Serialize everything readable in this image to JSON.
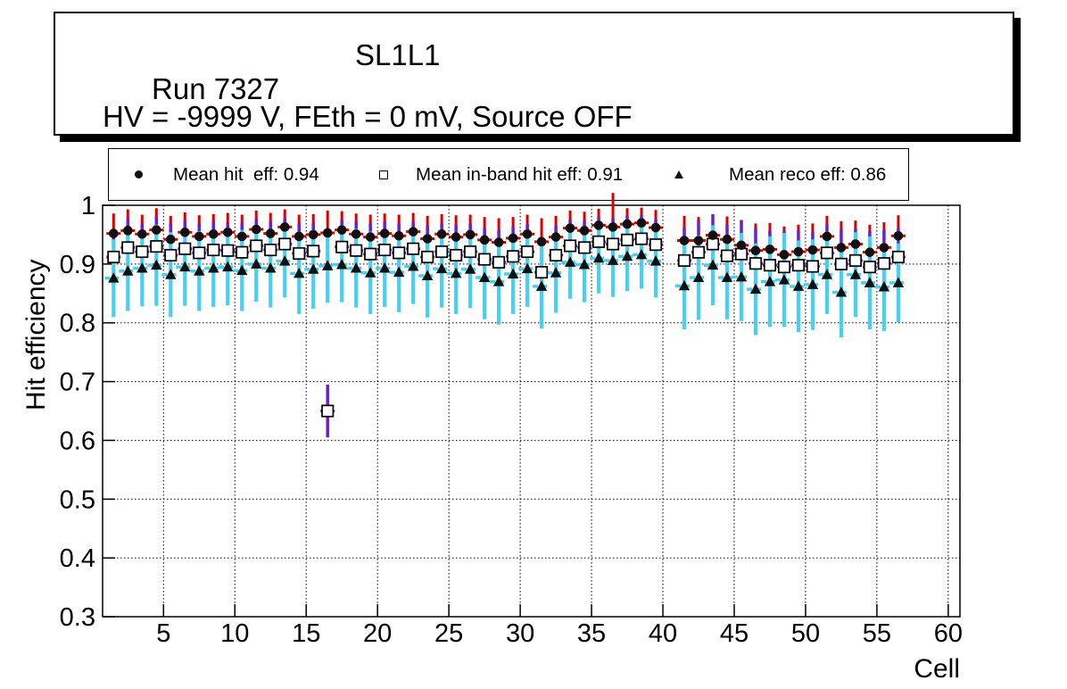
{
  "header": {
    "run_label": "Run 7327",
    "board_label": "SL1L1",
    "conditions_label": "HV = -9999 V, FEth = 0 mV, Source OFF"
  },
  "axes": {
    "y_title": "Hit efficiency",
    "x_title": "Cell"
  },
  "colors": {
    "hit_bar": "#d80000",
    "inband_bar": "#6a1fd6",
    "reco_bar": "#45d0f5",
    "marker": "#111111",
    "frame": "#000000"
  },
  "chart_data": {
    "type": "scatter",
    "title": "",
    "xlabel": "Cell",
    "ylabel": "Hit efficiency",
    "xlim": [
      0.73,
      60.82
    ],
    "ylim": [
      0.3,
      1.0
    ],
    "x_ticks": [
      5,
      10,
      15,
      20,
      25,
      30,
      35,
      40,
      45,
      50,
      55,
      60
    ],
    "y_ticks": [
      1,
      0.9,
      0.8,
      0.7,
      0.6,
      0.5,
      0.4,
      0.3
    ],
    "y_tick_labels": [
      "1",
      "0.9",
      "0.8",
      "0.7",
      "0.6",
      "0.5",
      "0.4",
      "0.3"
    ],
    "grid": true,
    "legend_position": "top",
    "point_x_offset": 0.5,
    "x_error_half_width": 0.5,
    "cells": [
      1,
      2,
      3,
      4,
      5,
      6,
      7,
      8,
      9,
      10,
      11,
      12,
      13,
      14,
      15,
      16,
      17,
      18,
      19,
      20,
      21,
      22,
      23,
      24,
      25,
      26,
      27,
      28,
      29,
      30,
      31,
      32,
      33,
      34,
      35,
      36,
      37,
      38,
      39,
      41,
      42,
      43,
      44,
      45,
      46,
      47,
      48,
      49,
      50,
      51,
      52,
      53,
      54,
      55,
      56
    ],
    "series": [
      {
        "name": "Mean hit  eff: 0.94",
        "mean": 0.94,
        "marker": "filled-circle",
        "marker_color": "#111111",
        "bar_color": "#d80000",
        "cap_style": "solid",
        "values": [
          0.952,
          0.957,
          0.951,
          0.958,
          0.942,
          0.954,
          0.947,
          0.951,
          0.954,
          0.947,
          0.959,
          0.952,
          0.963,
          0.947,
          0.95,
          0.953,
          0.958,
          0.951,
          0.946,
          0.952,
          0.948,
          0.955,
          0.943,
          0.951,
          0.946,
          0.95,
          0.941,
          0.937,
          0.944,
          0.951,
          0.938,
          0.946,
          0.961,
          0.957,
          0.966,
          0.963,
          0.968,
          0.97,
          0.962,
          0.94,
          0.94,
          0.949,
          0.942,
          0.932,
          0.923,
          0.925,
          0.916,
          0.921,
          0.924,
          0.947,
          0.928,
          0.934,
          0.92,
          0.928,
          0.948
        ],
        "errors": [
          0.034,
          0.036,
          0.033,
          0.037,
          0.04,
          0.034,
          0.036,
          0.034,
          0.033,
          0.037,
          0.032,
          0.035,
          0.03,
          0.037,
          0.035,
          0.038,
          0.032,
          0.035,
          0.038,
          0.034,
          0.036,
          0.032,
          0.039,
          0.034,
          0.037,
          0.034,
          0.039,
          0.041,
          0.036,
          0.033,
          0.04,
          0.036,
          0.03,
          0.032,
          0.028,
          0.058,
          0.027,
          0.026,
          0.03,
          0.042,
          0.04,
          0.036,
          0.039,
          0.043,
          0.046,
          0.045,
          0.048,
          0.046,
          0.045,
          0.035,
          0.045,
          0.04,
          0.047,
          0.043,
          0.035
        ]
      },
      {
        "name": "Mean in-band hit eff: 0.91",
        "mean": 0.91,
        "marker": "open-square",
        "marker_color": "#000000",
        "bar_color": "#6a1fd6",
        "cap_style": "solid",
        "values": [
          0.912,
          0.928,
          0.921,
          0.93,
          0.915,
          0.926,
          0.919,
          0.924,
          0.923,
          0.92,
          0.931,
          0.924,
          0.934,
          0.918,
          0.922,
          0.65,
          0.929,
          0.923,
          0.917,
          0.924,
          0.919,
          0.926,
          0.912,
          0.921,
          0.915,
          0.921,
          0.908,
          0.903,
          0.913,
          0.921,
          0.886,
          0.915,
          0.931,
          0.928,
          0.938,
          0.934,
          0.941,
          0.943,
          0.933,
          0.906,
          0.92,
          0.934,
          0.914,
          0.917,
          0.901,
          0.898,
          0.895,
          0.898,
          0.896,
          0.919,
          0.9,
          0.906,
          0.895,
          0.901,
          0.912
        ],
        "errors": [
          0.048,
          0.05,
          0.047,
          0.051,
          0.054,
          0.048,
          0.05,
          0.048,
          0.047,
          0.051,
          0.046,
          0.049,
          0.044,
          0.051,
          0.049,
          0.045,
          0.046,
          0.049,
          0.052,
          0.048,
          0.05,
          0.046,
          0.053,
          0.048,
          0.051,
          0.048,
          0.053,
          0.055,
          0.05,
          0.047,
          0.054,
          0.05,
          0.044,
          0.046,
          0.042,
          0.044,
          0.041,
          0.04,
          0.044,
          0.056,
          0.054,
          0.05,
          0.053,
          0.057,
          0.06,
          0.059,
          0.062,
          0.06,
          0.059,
          0.049,
          0.059,
          0.054,
          0.061,
          0.057,
          0.049
        ]
      },
      {
        "name": "Mean reco eff: 0.86",
        "mean": 0.86,
        "marker": "filled-triangle",
        "marker_color": "#111111",
        "bar_color": "#45d0f5",
        "cap_style": "dashed",
        "values": [
          0.876,
          0.888,
          0.893,
          0.898,
          0.882,
          0.895,
          0.888,
          0.893,
          0.895,
          0.889,
          0.9,
          0.893,
          0.905,
          0.884,
          0.891,
          0.897,
          0.899,
          0.893,
          0.885,
          0.893,
          0.886,
          0.896,
          0.88,
          0.892,
          0.884,
          0.891,
          0.877,
          0.87,
          0.883,
          0.892,
          0.862,
          0.885,
          0.903,
          0.899,
          0.91,
          0.906,
          0.913,
          0.916,
          0.905,
          0.863,
          0.877,
          0.898,
          0.877,
          0.878,
          0.857,
          0.87,
          0.873,
          0.862,
          0.865,
          0.882,
          0.852,
          0.882,
          0.868,
          0.861,
          0.868
        ],
        "errors": [
          0.066,
          0.068,
          0.065,
          0.069,
          0.072,
          0.066,
          0.068,
          0.066,
          0.065,
          0.069,
          0.064,
          0.067,
          0.062,
          0.069,
          0.067,
          0.063,
          0.064,
          0.067,
          0.07,
          0.066,
          0.068,
          0.064,
          0.071,
          0.066,
          0.069,
          0.066,
          0.071,
          0.073,
          0.068,
          0.065,
          0.072,
          0.068,
          0.062,
          0.064,
          0.06,
          0.062,
          0.059,
          0.058,
          0.062,
          0.074,
          0.072,
          0.068,
          0.071,
          0.075,
          0.078,
          0.077,
          0.08,
          0.078,
          0.077,
          0.067,
          0.077,
          0.072,
          0.079,
          0.075,
          0.067
        ]
      }
    ]
  }
}
